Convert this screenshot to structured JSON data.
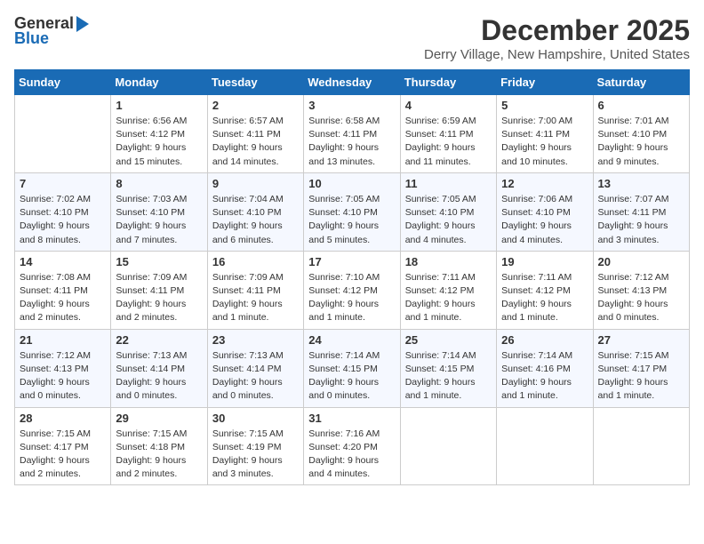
{
  "logo": {
    "general": "General",
    "blue": "Blue"
  },
  "title": {
    "month": "December 2025",
    "location": "Derry Village, New Hampshire, United States"
  },
  "headers": [
    "Sunday",
    "Monday",
    "Tuesday",
    "Wednesday",
    "Thursday",
    "Friday",
    "Saturday"
  ],
  "weeks": [
    [
      {
        "day": "",
        "info": ""
      },
      {
        "day": "1",
        "info": "Sunrise: 6:56 AM\nSunset: 4:12 PM\nDaylight: 9 hours\nand 15 minutes."
      },
      {
        "day": "2",
        "info": "Sunrise: 6:57 AM\nSunset: 4:11 PM\nDaylight: 9 hours\nand 14 minutes."
      },
      {
        "day": "3",
        "info": "Sunrise: 6:58 AM\nSunset: 4:11 PM\nDaylight: 9 hours\nand 13 minutes."
      },
      {
        "day": "4",
        "info": "Sunrise: 6:59 AM\nSunset: 4:11 PM\nDaylight: 9 hours\nand 11 minutes."
      },
      {
        "day": "5",
        "info": "Sunrise: 7:00 AM\nSunset: 4:11 PM\nDaylight: 9 hours\nand 10 minutes."
      },
      {
        "day": "6",
        "info": "Sunrise: 7:01 AM\nSunset: 4:10 PM\nDaylight: 9 hours\nand 9 minutes."
      }
    ],
    [
      {
        "day": "7",
        "info": "Sunrise: 7:02 AM\nSunset: 4:10 PM\nDaylight: 9 hours\nand 8 minutes."
      },
      {
        "day": "8",
        "info": "Sunrise: 7:03 AM\nSunset: 4:10 PM\nDaylight: 9 hours\nand 7 minutes."
      },
      {
        "day": "9",
        "info": "Sunrise: 7:04 AM\nSunset: 4:10 PM\nDaylight: 9 hours\nand 6 minutes."
      },
      {
        "day": "10",
        "info": "Sunrise: 7:05 AM\nSunset: 4:10 PM\nDaylight: 9 hours\nand 5 minutes."
      },
      {
        "day": "11",
        "info": "Sunrise: 7:05 AM\nSunset: 4:10 PM\nDaylight: 9 hours\nand 4 minutes."
      },
      {
        "day": "12",
        "info": "Sunrise: 7:06 AM\nSunset: 4:10 PM\nDaylight: 9 hours\nand 4 minutes."
      },
      {
        "day": "13",
        "info": "Sunrise: 7:07 AM\nSunset: 4:11 PM\nDaylight: 9 hours\nand 3 minutes."
      }
    ],
    [
      {
        "day": "14",
        "info": "Sunrise: 7:08 AM\nSunset: 4:11 PM\nDaylight: 9 hours\nand 2 minutes."
      },
      {
        "day": "15",
        "info": "Sunrise: 7:09 AM\nSunset: 4:11 PM\nDaylight: 9 hours\nand 2 minutes."
      },
      {
        "day": "16",
        "info": "Sunrise: 7:09 AM\nSunset: 4:11 PM\nDaylight: 9 hours\nand 1 minute."
      },
      {
        "day": "17",
        "info": "Sunrise: 7:10 AM\nSunset: 4:12 PM\nDaylight: 9 hours\nand 1 minute."
      },
      {
        "day": "18",
        "info": "Sunrise: 7:11 AM\nSunset: 4:12 PM\nDaylight: 9 hours\nand 1 minute."
      },
      {
        "day": "19",
        "info": "Sunrise: 7:11 AM\nSunset: 4:12 PM\nDaylight: 9 hours\nand 1 minute."
      },
      {
        "day": "20",
        "info": "Sunrise: 7:12 AM\nSunset: 4:13 PM\nDaylight: 9 hours\nand 0 minutes."
      }
    ],
    [
      {
        "day": "21",
        "info": "Sunrise: 7:12 AM\nSunset: 4:13 PM\nDaylight: 9 hours\nand 0 minutes."
      },
      {
        "day": "22",
        "info": "Sunrise: 7:13 AM\nSunset: 4:14 PM\nDaylight: 9 hours\nand 0 minutes."
      },
      {
        "day": "23",
        "info": "Sunrise: 7:13 AM\nSunset: 4:14 PM\nDaylight: 9 hours\nand 0 minutes."
      },
      {
        "day": "24",
        "info": "Sunrise: 7:14 AM\nSunset: 4:15 PM\nDaylight: 9 hours\nand 0 minutes."
      },
      {
        "day": "25",
        "info": "Sunrise: 7:14 AM\nSunset: 4:15 PM\nDaylight: 9 hours\nand 1 minute."
      },
      {
        "day": "26",
        "info": "Sunrise: 7:14 AM\nSunset: 4:16 PM\nDaylight: 9 hours\nand 1 minute."
      },
      {
        "day": "27",
        "info": "Sunrise: 7:15 AM\nSunset: 4:17 PM\nDaylight: 9 hours\nand 1 minute."
      }
    ],
    [
      {
        "day": "28",
        "info": "Sunrise: 7:15 AM\nSunset: 4:17 PM\nDaylight: 9 hours\nand 2 minutes."
      },
      {
        "day": "29",
        "info": "Sunrise: 7:15 AM\nSunset: 4:18 PM\nDaylight: 9 hours\nand 2 minutes."
      },
      {
        "day": "30",
        "info": "Sunrise: 7:15 AM\nSunset: 4:19 PM\nDaylight: 9 hours\nand 3 minutes."
      },
      {
        "day": "31",
        "info": "Sunrise: 7:16 AM\nSunset: 4:20 PM\nDaylight: 9 hours\nand 4 minutes."
      },
      {
        "day": "",
        "info": ""
      },
      {
        "day": "",
        "info": ""
      },
      {
        "day": "",
        "info": ""
      }
    ]
  ]
}
